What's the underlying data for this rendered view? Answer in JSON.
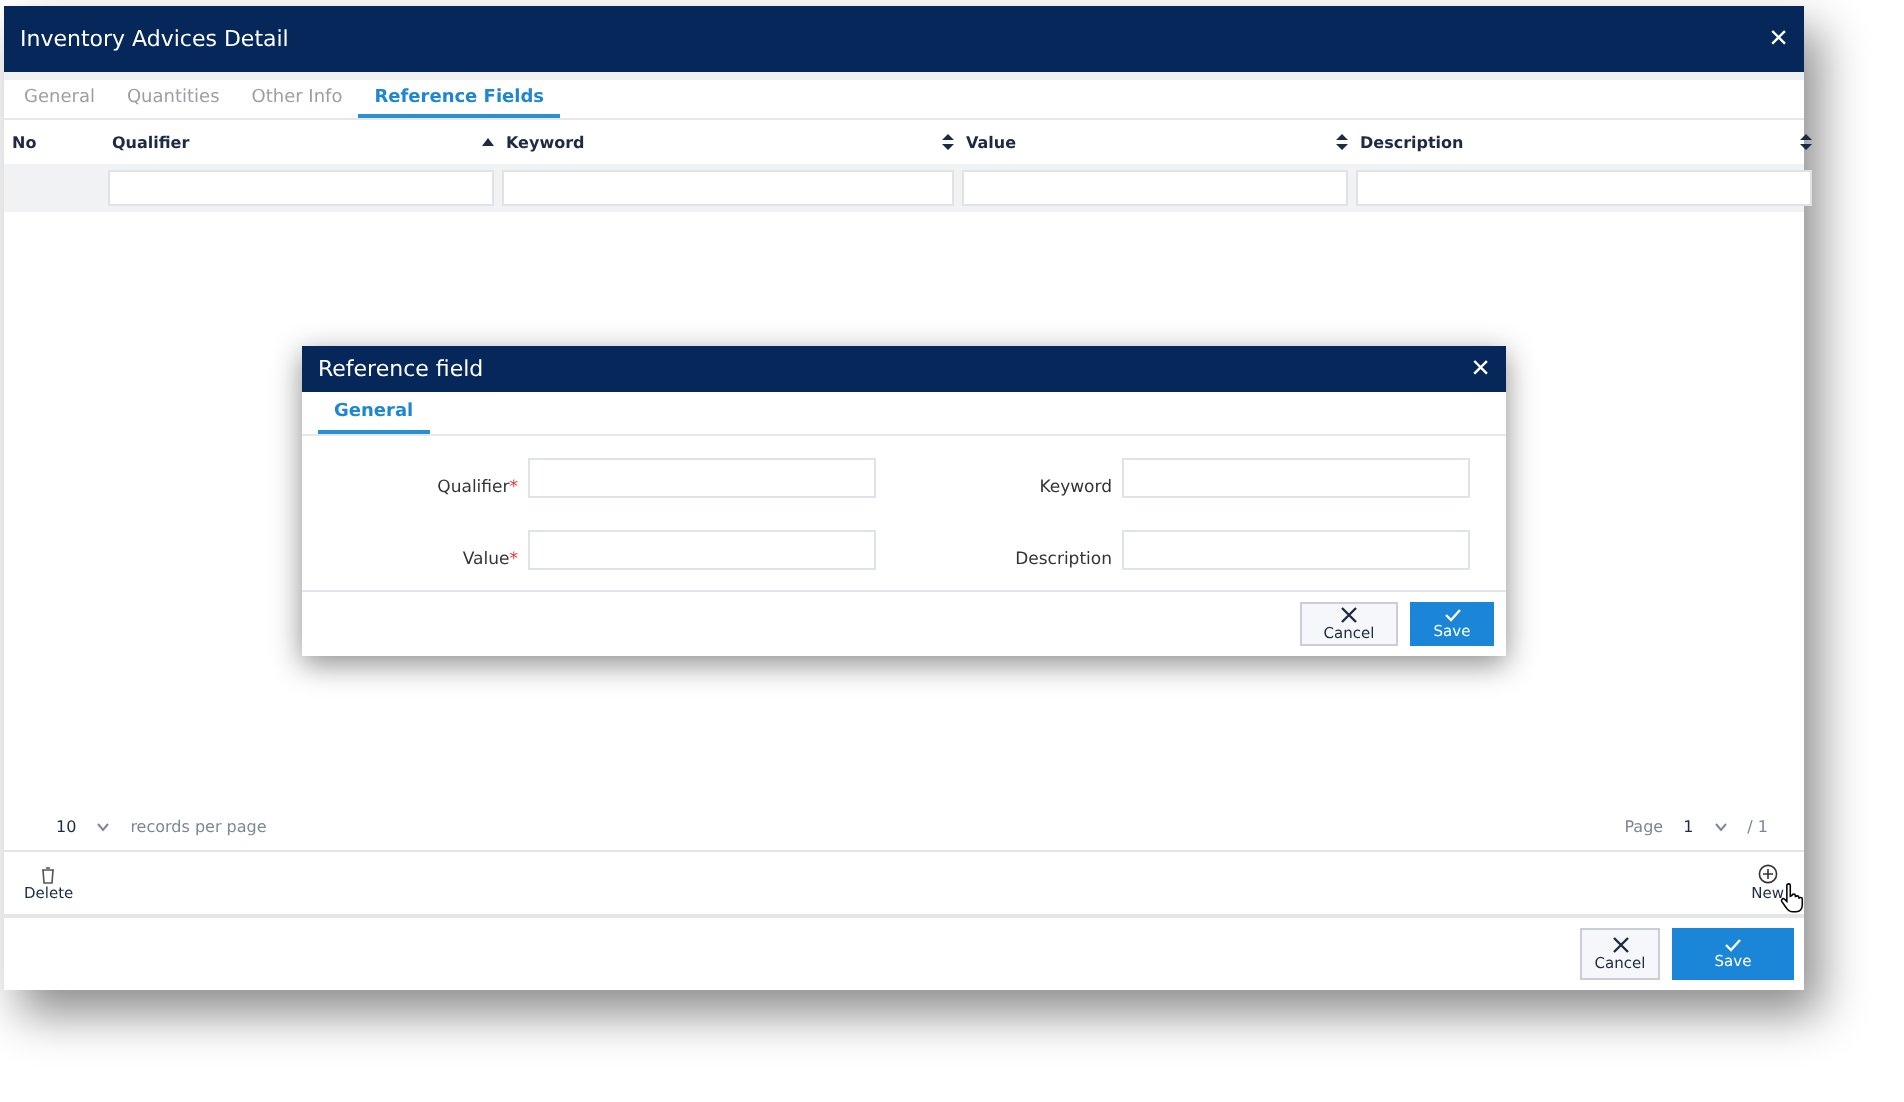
{
  "window": {
    "title": "Inventory Advices Detail",
    "close": "×"
  },
  "tabs": [
    {
      "label": "General",
      "selected": false
    },
    {
      "label": "Quantities",
      "selected": false
    },
    {
      "label": "Other Info",
      "selected": false
    },
    {
      "label": "Reference Fields",
      "selected": true
    }
  ],
  "table": {
    "columns": [
      {
        "label": "No",
        "kind": "plain"
      },
      {
        "label": "Qualifier",
        "kind": "sorted"
      },
      {
        "label": "Keyword",
        "kind": "sortable"
      },
      {
        "label": "Value",
        "kind": "sortable"
      },
      {
        "label": "Description",
        "kind": "sortable"
      }
    ]
  },
  "pagination": {
    "page_size": "10",
    "records_label": "records per page",
    "page_label": "Page",
    "page": "1",
    "total": "/ 1"
  },
  "toolbar": {
    "delete": "Delete",
    "new": "New"
  },
  "footer": {
    "cancel": "Cancel",
    "save": "Save"
  },
  "dialog": {
    "title": "Reference field",
    "close": "×",
    "tabs": [
      {
        "label": "General",
        "selected": true
      }
    ],
    "fields": [
      {
        "label": "Qualifier",
        "required_mark": "*"
      },
      {
        "label": "Keyword"
      },
      {
        "label": "Value",
        "required_mark": "*"
      },
      {
        "label": "Description"
      }
    ],
    "cancel": "Cancel",
    "save": "Save"
  }
}
